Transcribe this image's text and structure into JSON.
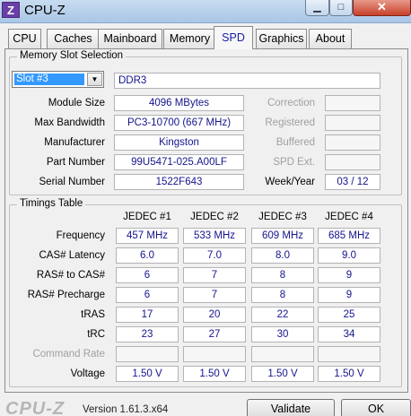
{
  "window": {
    "title": "CPU-Z",
    "icon_letter": "Z",
    "min_glyph": "▁",
    "max_glyph": "□",
    "close_glyph": "✕"
  },
  "tabs": [
    "CPU",
    "Caches",
    "Mainboard",
    "Memory",
    "SPD",
    "Graphics",
    "About"
  ],
  "active_tab": "SPD",
  "slot_section": {
    "label": "Memory Slot Selection",
    "selected_slot": "Slot #3",
    "memory_type": "DDR3",
    "rows": [
      {
        "label": "Module Size",
        "value": "4096 MBytes",
        "right_label": "Correction",
        "right_value": ""
      },
      {
        "label": "Max Bandwidth",
        "value": "PC3-10700 (667 MHz)",
        "right_label": "Registered",
        "right_value": ""
      },
      {
        "label": "Manufacturer",
        "value": "Kingston",
        "right_label": "Buffered",
        "right_value": ""
      },
      {
        "label": "Part Number",
        "value": "99U5471-025.A00LF",
        "right_label": "SPD Ext.",
        "right_value": ""
      },
      {
        "label": "Serial Number",
        "value": "1522F643",
        "right_label": "Week/Year",
        "right_value": "03 / 12"
      }
    ]
  },
  "timings": {
    "label": "Timings Table",
    "columns": [
      "JEDEC #1",
      "JEDEC #2",
      "JEDEC #3",
      "JEDEC #4"
    ],
    "rows": [
      {
        "label": "Frequency",
        "values": [
          "457 MHz",
          "533 MHz",
          "609 MHz",
          "685 MHz"
        ]
      },
      {
        "label": "CAS# Latency",
        "values": [
          "6.0",
          "7.0",
          "8.0",
          "9.0"
        ]
      },
      {
        "label": "RAS# to CAS#",
        "values": [
          "6",
          "7",
          "8",
          "9"
        ]
      },
      {
        "label": "RAS# Precharge",
        "values": [
          "6",
          "7",
          "8",
          "9"
        ]
      },
      {
        "label": "tRAS",
        "values": [
          "17",
          "20",
          "22",
          "25"
        ]
      },
      {
        "label": "tRC",
        "values": [
          "23",
          "27",
          "30",
          "34"
        ]
      },
      {
        "label": "Command Rate",
        "values": [
          "",
          "",
          "",
          ""
        ]
      },
      {
        "label": "Voltage",
        "values": [
          "1.50 V",
          "1.50 V",
          "1.50 V",
          "1.50 V"
        ]
      }
    ]
  },
  "footer": {
    "logo": "CPU-Z",
    "version": "Version 1.61.3.x64",
    "validate_label": "Validate",
    "ok_label": "OK"
  }
}
